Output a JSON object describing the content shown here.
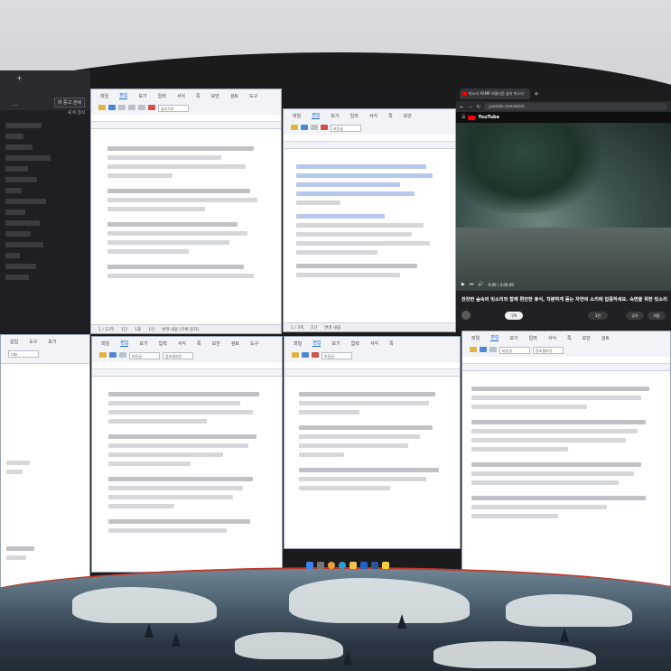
{
  "explorer": {
    "title_right": "마 중고 관세",
    "action_label": "새 위 정식",
    "more": "..."
  },
  "doc1": {
    "tabs": [
      "파일",
      "편집",
      "보기",
      "입력",
      "서식",
      "쪽",
      "보안",
      "검토",
      "도구"
    ],
    "style_box": "글자모양",
    "status": [
      "1 / 12쪽",
      "1단",
      "1줄",
      "1칸",
      "변경 내용 [기록 중지]"
    ]
  },
  "doc2": {
    "tabs": [
      "파일",
      "편집",
      "보기",
      "입력",
      "서식",
      "쪽",
      "보안"
    ],
    "style_box": "바탕글",
    "status": [
      "1 / 3쪽",
      "1단",
      "변경 내용"
    ]
  },
  "browser": {
    "tab_title": "빗소리 ASMR 아름다운 숲속 빗소리",
    "url": "youtube.com/watch",
    "yt_logo": "YouTube",
    "caption": "잔잔한 숲속의 빗소리와 함께 편안한 휴식, 차분하게 듣는 자연의 소리에 집중하세요. 숙면을 위한 빗소리",
    "time": "0:00 / 3:00:00",
    "subscribe": "구독",
    "likes": "1만",
    "share": "공유",
    "save": "저장"
  },
  "doc3": {
    "tabs": [
      "파일",
      "편집",
      "보기",
      "입력",
      "서식",
      "쪽",
      "보안",
      "검토",
      "도구"
    ],
    "style_box": "바탕글",
    "font_box": "함초롬바탕"
  },
  "doc4": {
    "tabs": [
      "파일",
      "편집",
      "보기",
      "입력",
      "서식",
      "쪽"
    ],
    "style_box": "바탕글"
  },
  "doc5": {
    "tabs": [
      "파일",
      "편집",
      "보기",
      "입력",
      "서식",
      "쪽",
      "보안",
      "검토"
    ],
    "style_box": "바탕글",
    "font_box": "함초롬바탕"
  },
  "left_small": {
    "tabs": [
      "삽입",
      "도구",
      "보기"
    ],
    "style_box": "대표"
  },
  "taskbar_icons": [
    "windows-icon",
    "search-icon",
    "chrome-icon",
    "edge-icon",
    "folder-icon",
    "hwp-icon",
    "word-icon",
    "notes-icon"
  ],
  "colors": {
    "accent": "#1a66d2",
    "youtube_red": "#ff0000",
    "explorer_bg": "#1e1f22"
  }
}
